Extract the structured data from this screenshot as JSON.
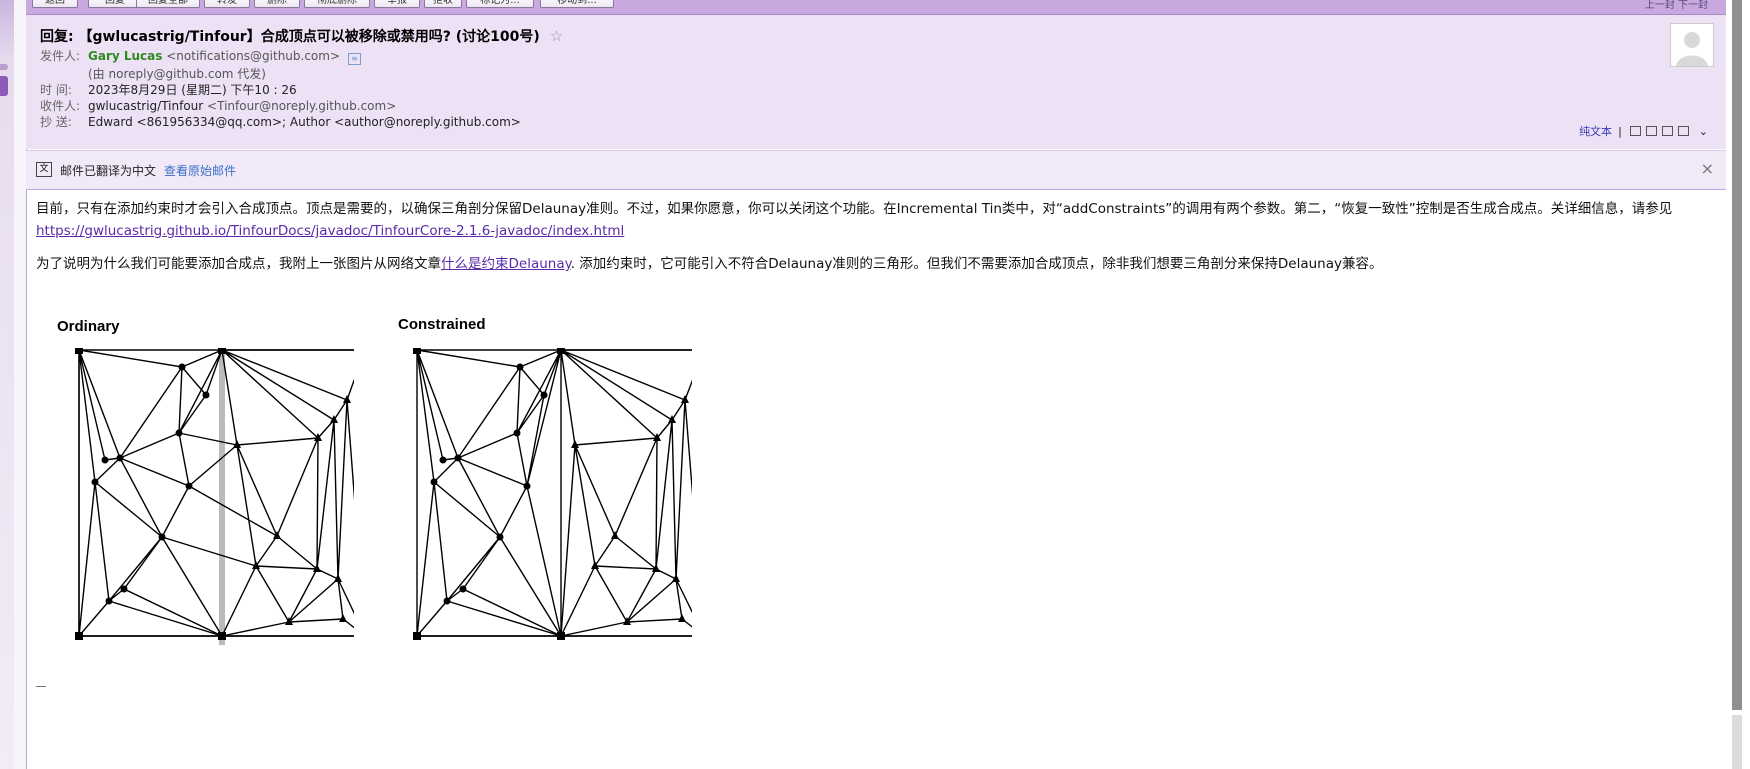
{
  "toolbar": {
    "buttons": [
      "返回",
      "回复",
      "回复全部",
      "转发",
      "删除",
      "彻底删除",
      "举报",
      "拒收",
      "标记为...",
      "移动到..."
    ],
    "right_label": "上一封 下一封"
  },
  "email": {
    "subject": "回复: 【gwlucastrig/Tinfour】合成顶点可以被移除或禁用吗? (讨论100号)",
    "star": "☆",
    "from_label": "发件人:",
    "from_name": "Gary Lucas",
    "from_addr": "<notifications@github.com>",
    "on_behalf": "(由 noreply@github.com 代发)",
    "time_label": "时 间:",
    "time": "2023年8月29日 (星期二) 下午10 : 26",
    "to_label": "收件人:",
    "to_name": "gwlucastrig/Tinfour",
    "to_addr": "<Tinfour@noreply.github.com>",
    "cc_label": "抄 送:",
    "cc": "Edward  <861956334@qq.com>; Author <author@noreply.github.com>",
    "plaintext_link": "纯文本",
    "plaintext_sep": "|"
  },
  "translation": {
    "notice": "邮件已翻译为中文",
    "view_original": "查看原始邮件",
    "close": "×"
  },
  "body": {
    "p1_text": "目前，只有在添加约束时才会引入合成顶点。顶点是需要的，以确保三角剖分保留Delaunay准则。不过，如果你愿意，你可以关闭这个功能。在Incremental Tin类中，对“addConstraints”的调用有两个参数。第二，“恢复一致性”控制是否生成合成点。关详细信息，请参见",
    "p1_link": "https://gwlucastrig.github.io/TinfourDocs/javadoc/TinfourCore-2.1.6-javadoc/index.html",
    "p2_text_a": "为了说明为什么我们可能要添加合成点，我附上一张图片从网络文章",
    "p2_link": "什么是约束Delaunay",
    "p2_text_b": ". 添加约束时，它可能引入不符合Delaunay准则的三角形。但我们不需要添加合成顶点，除非我们想要三角剖分来保持Delaunay兼容。"
  },
  "figures": {
    "left_title": "Ordinary",
    "right_title": "Constrained"
  },
  "colors": {
    "toolbar": "#c7a9e0",
    "header_bg": "#ede1f6",
    "sender_green": "#2e8b1e",
    "link_purple": "#5b2aa8",
    "link_blue": "#3a6ec8"
  }
}
